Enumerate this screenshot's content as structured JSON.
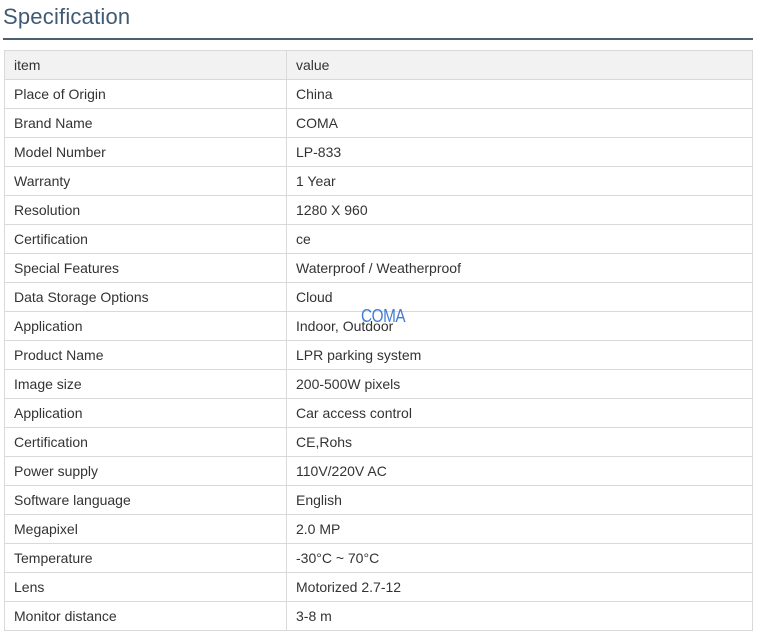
{
  "title": "Specification",
  "table": {
    "header": [
      "item",
      "value"
    ],
    "rows": [
      [
        "Place of Origin",
        "China"
      ],
      [
        "Brand Name",
        "COMA"
      ],
      [
        "Model Number",
        "LP-833"
      ],
      [
        "Warranty",
        "1 Year"
      ],
      [
        "Resolution",
        "1280 X 960"
      ],
      [
        "Certification",
        "ce"
      ],
      [
        "Special Features",
        "Waterproof / Weatherproof"
      ],
      [
        "Data Storage Options",
        "Cloud"
      ],
      [
        "Application",
        "Indoor, Outdoor"
      ],
      [
        "Product Name",
        "LPR parking system"
      ],
      [
        "Image size",
        "200-500W pixels"
      ],
      [
        "Application",
        "Car access control"
      ],
      [
        "Certification",
        "CE,Rohs"
      ],
      [
        "Power supply",
        "110V/220V AC"
      ],
      [
        "Software language",
        "English"
      ],
      [
        "Megapixel",
        "2.0 MP"
      ],
      [
        "Temperature",
        "-30°C ~ 70°C"
      ],
      [
        "Lens",
        "Motorized 2.7-12"
      ],
      [
        "Monitor distance",
        "3-8 m"
      ]
    ]
  },
  "watermark": "COMA"
}
